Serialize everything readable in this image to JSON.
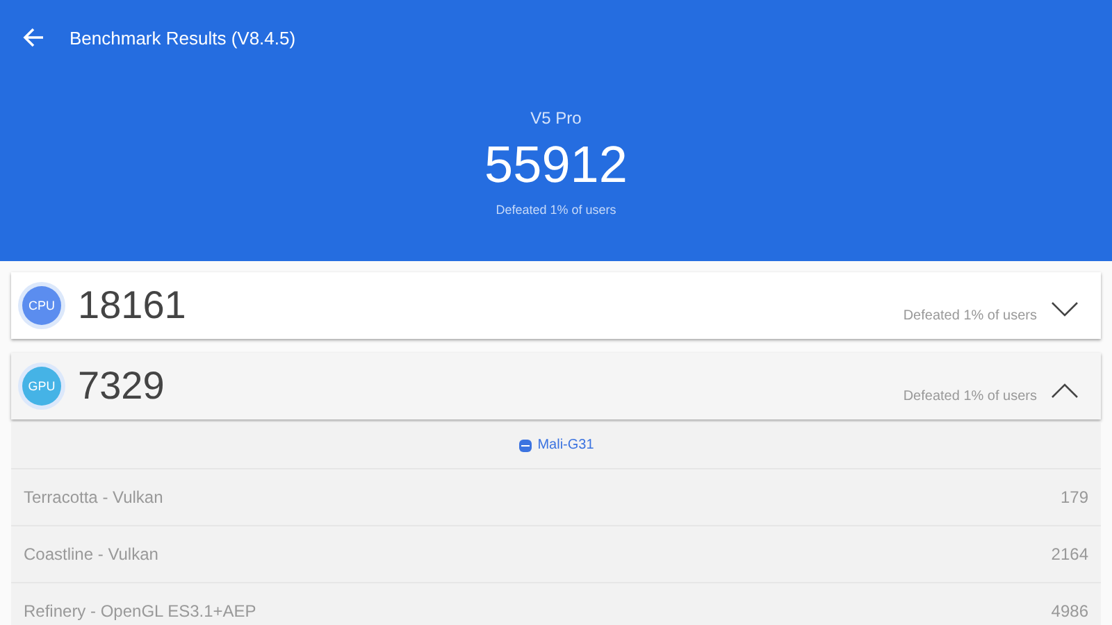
{
  "app_bar": {
    "title": "Benchmark Results (V8.4.5)"
  },
  "summary": {
    "device": "V5 Pro",
    "score": "55912",
    "defeated": "Defeated 1% of users"
  },
  "sections": [
    {
      "badge": "CPU",
      "color": "#5b8def",
      "score": "18161",
      "defeated": "Defeated 1% of users",
      "expanded": false
    },
    {
      "badge": "GPU",
      "color": "#45b3e6",
      "score": "7329",
      "defeated": "Defeated 1% of users",
      "expanded": true,
      "chip": "Mali-G31",
      "tests": [
        {
          "name": "Terracotta - Vulkan",
          "score": "179"
        },
        {
          "name": "Coastline - Vulkan",
          "score": "2164"
        },
        {
          "name": "Refinery - OpenGL ES3.1+AEP",
          "score": "4986"
        }
      ]
    }
  ]
}
